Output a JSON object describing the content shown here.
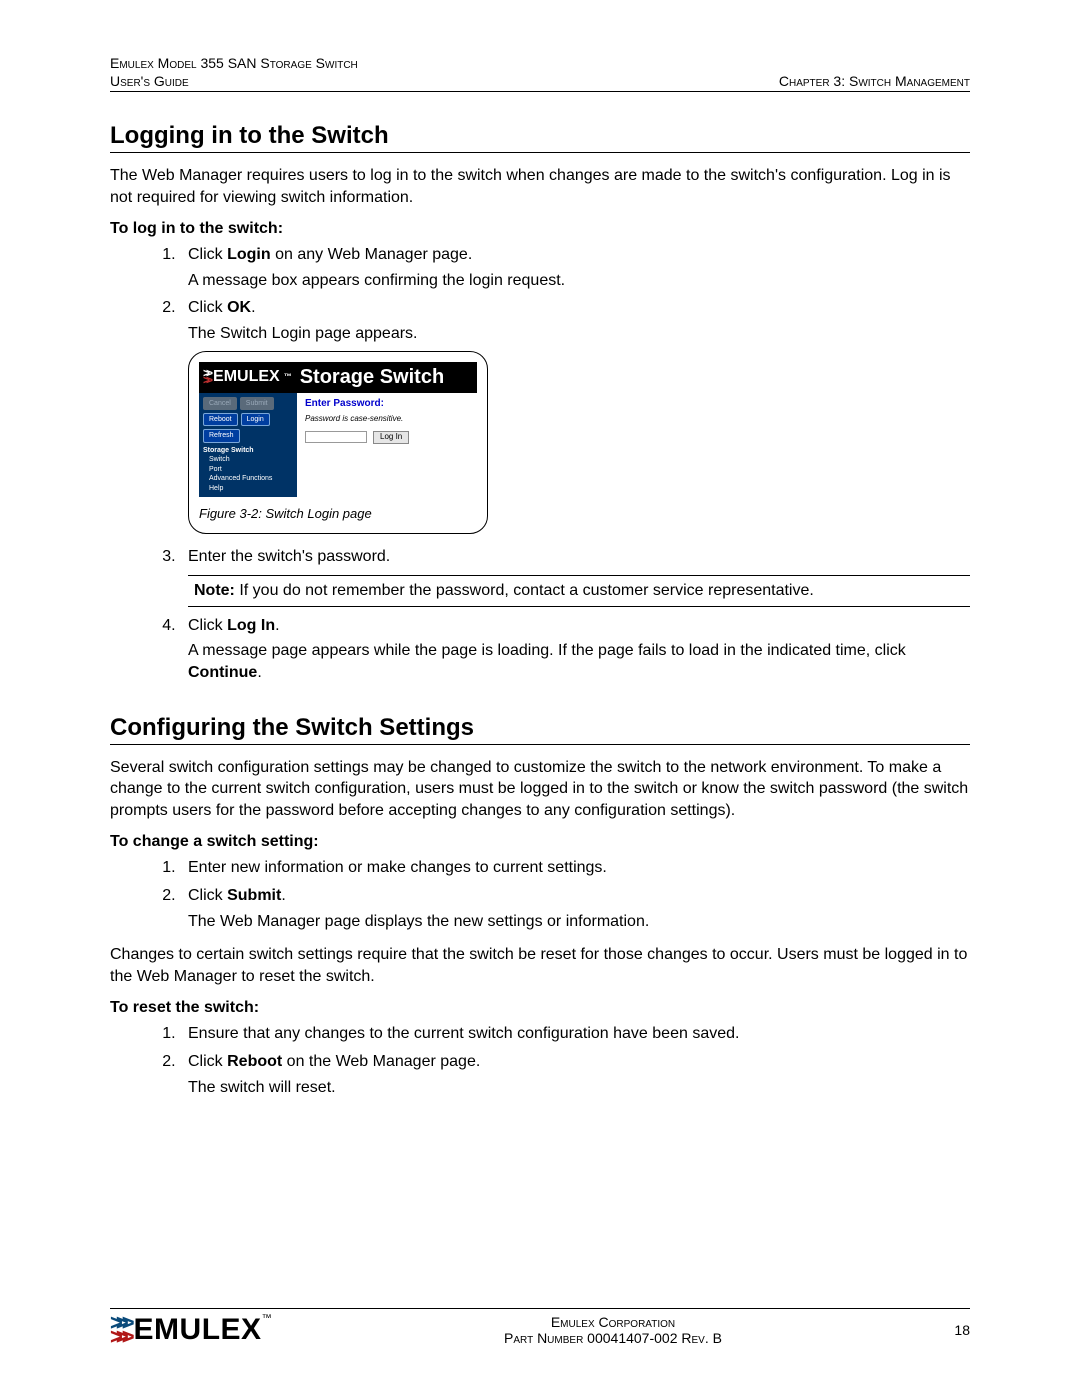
{
  "header": {
    "product": "Emulex Model 355 SAN Storage Switch",
    "guide": "User's Guide",
    "chapter": "Chapter 3: Switch Management"
  },
  "section1": {
    "title": "Logging in to the Switch",
    "intro": "The Web Manager requires users to log in to the switch when changes are made to the switch's configuration. Log in is not required for viewing switch information.",
    "proc_heading": "To log in to the switch:",
    "step1_a": "Click ",
    "step1_b": "Login",
    "step1_c": " on any Web Manager page.",
    "step1_body": "A message box appears confirming the login request.",
    "step2_a": "Click ",
    "step2_b": "OK",
    "step2_c": ".",
    "step2_body": "The Switch Login page appears.",
    "step3": "Enter the switch's password.",
    "note_label": "Note:",
    "note_text": " If you do not remember the password, contact a customer service representative.",
    "step4_a": "Click ",
    "step4_b": "Log In",
    "step4_c": ".",
    "step4_body_a": "A message page appears while the page is loading. If the page fails to load in the indicated time, click ",
    "step4_body_b": "Continue",
    "step4_body_c": "."
  },
  "figure": {
    "brand": "EMULEX",
    "brand_suffix": "Storage Switch",
    "btn_disabled1": "Cancel",
    "btn_disabled2": "Submit",
    "btn_reboot": "Reboot",
    "btn_login": "Login",
    "btn_refresh": "Refresh",
    "tree_root": "Storage Switch",
    "tree_items": [
      "Switch",
      "Port",
      "Advanced Functions",
      "Help"
    ],
    "enter_password": "Enter Password:",
    "pw_note": "Password is case-sensitive.",
    "login_button": "Log In",
    "caption": "Figure 3-2: Switch Login page"
  },
  "section2": {
    "title": "Configuring the Switch Settings",
    "intro": "Several switch configuration settings may be changed to customize the switch to the network environment. To make a change to the current switch configuration, users must be logged in to the switch or know the switch password (the switch prompts users for the password before accepting changes to any configuration settings).",
    "proc1_heading": "To change a switch setting:",
    "p1_step1": "Enter new information or make changes to current settings.",
    "p1_step2_a": "Click ",
    "p1_step2_b": "Submit",
    "p1_step2_c": ".",
    "p1_step2_body": "The Web Manager page displays the new settings or information.",
    "mid": "Changes to certain switch settings require that the switch be reset for those changes to occur. Users must be logged in to the Web Manager to reset the switch.",
    "proc2_heading": "To reset the switch:",
    "p2_step1": "Ensure that any changes to the current switch configuration have been saved.",
    "p2_step2_a": "Click ",
    "p2_step2_b": "Reboot",
    "p2_step2_c": " on the Web Manager page.",
    "p2_step2_body": "The switch will reset."
  },
  "footer": {
    "corp": "Emulex Corporation",
    "part": "Part Number 00041407-002 Rev. B",
    "page": "18",
    "logo_text": "EMULEX"
  }
}
